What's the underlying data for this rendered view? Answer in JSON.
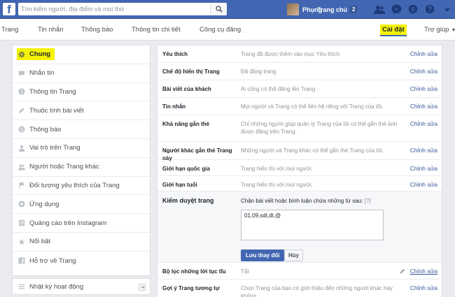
{
  "topbar": {
    "logo": "f",
    "search_placeholder": "Tìm kiếm người, địa điểm và mọi thứ",
    "user_name": "Phụng",
    "home_label": "Trang chủ",
    "home_count": "2",
    "icons": [
      "friend-requests-icon",
      "messages-icon",
      "notifications-icon",
      "privacy-icon"
    ]
  },
  "pagenav": {
    "tabs": [
      {
        "label": "Trang"
      },
      {
        "label": "Tin nhắn"
      },
      {
        "label": "Thông báo"
      },
      {
        "label": "Thông tin chi tiết"
      },
      {
        "label": "Công cụ đăng"
      },
      {
        "label": "Cài đặt"
      },
      {
        "label": "Trợ giúp"
      }
    ],
    "active_tab": "Cài đặt"
  },
  "sidebar": {
    "items": [
      {
        "label": "Chung",
        "icon": "gear-icon"
      },
      {
        "label": "Nhắn tin",
        "icon": "message-icon"
      },
      {
        "label": "Thông tin Trang",
        "icon": "info-icon"
      },
      {
        "label": "Thuộc tính bài viết",
        "icon": "pen-icon"
      },
      {
        "label": "Thông báo",
        "icon": "globe-icon"
      },
      {
        "label": "Vai trò trên Trang",
        "icon": "person-icon"
      },
      {
        "label": "Người hoặc Trang khác",
        "icon": "people-icon"
      },
      {
        "label": "Đối tượng yêu thích của Trang",
        "icon": "flag-icon"
      },
      {
        "label": "Ứng dụng",
        "icon": "apps-icon"
      },
      {
        "label": "Quảng cáo trên Instagram",
        "icon": "instagram-icon"
      },
      {
        "label": "Nổi bật",
        "icon": "star-icon"
      },
      {
        "label": "Hỗ trợ về Trang",
        "icon": "facebook-icon"
      }
    ],
    "activity_log": "Nhật ký hoạt động"
  },
  "settings": {
    "rows": [
      {
        "label": "Yêu thích",
        "value": "Trang đã được thêm vào mục Yêu thích",
        "action": "Chỉnh sửa"
      },
      {
        "label": "Chế độ hiển thị Trang",
        "value": "Đã đăng trang",
        "action": "Chỉnh sửa"
      },
      {
        "label": "Bài viết của khách",
        "value": "Ai cũng có thể đăng lên Trang",
        "action": "Chỉnh sửa"
      },
      {
        "label": "Tin nhắn",
        "value": "Mọi người và Trang có thể liên hệ riêng với Trang của tôi.",
        "action": "Chỉnh sửa"
      },
      {
        "label": "Khả năng gắn thẻ",
        "value": "Chỉ những người giúp quản lý Trang của tôi có thể gắn thẻ ảnh được đăng trên Trang.",
        "action": "Chỉnh sửa"
      },
      {
        "label": "Người khác gắn thẻ Trang này",
        "value": "Những người và Trang khác có thể gắn thẻ Trang của tôi.",
        "action": "Chỉnh sửa"
      },
      {
        "label": "Giới hạn quốc gia",
        "value": "Trang hiển thị với mọi người.",
        "action": "Chỉnh sửa"
      },
      {
        "label": "Giới hạn tuổi",
        "value": "Trang hiển thị với mọi người.",
        "action": "Chỉnh sửa"
      }
    ],
    "moderation": {
      "label": "Kiểm duyệt trang",
      "description": "Chặn bài viết hoặc bình luận chứa những từ sau:",
      "help": "[?]",
      "keywords": "01,09,sdt,dt,@",
      "save_label": "Lưu thay đổi",
      "cancel_label": "Hủy"
    },
    "after_rows": [
      {
        "label": "Bộ lọc những lời tục tĩu",
        "value": "Tắt",
        "action": "Chỉnh sửa"
      },
      {
        "label": "Gợi ý Trang tương tự",
        "value": "Chọn Trang của bạn có giới thiệu đến những người khác hay không",
        "action": "Chỉnh sửa"
      }
    ]
  },
  "colors": {
    "facebook_blue": "#4267b2",
    "highlight": "#f5f20a",
    "link": "#365899"
  }
}
